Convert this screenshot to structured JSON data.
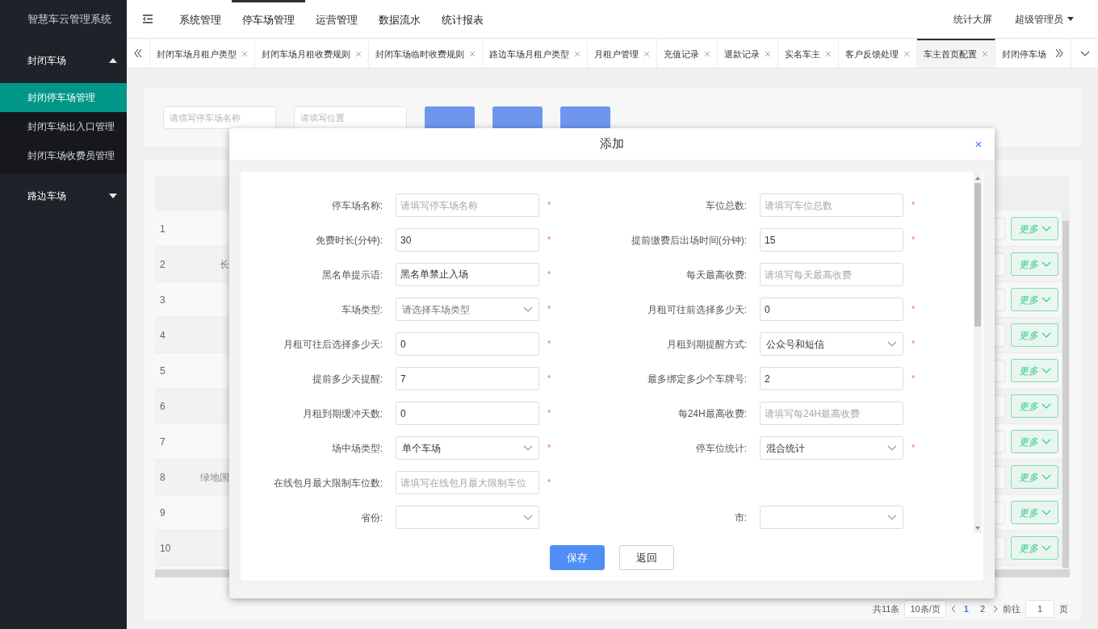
{
  "sidebar": {
    "title": "智慧车云管理系统",
    "groups": [
      {
        "label": "封闭车场",
        "expanded": true,
        "children": [
          {
            "label": "封闭停车场管理",
            "selected": true
          },
          {
            "label": "封闭车场出入口管理",
            "selected": false
          },
          {
            "label": "封闭车场收费员管理",
            "selected": false
          }
        ]
      },
      {
        "label": "路边车场",
        "expanded": false
      }
    ]
  },
  "header": {
    "menus": [
      {
        "label": "系统管理",
        "selected": false
      },
      {
        "label": "停车场管理",
        "selected": true
      },
      {
        "label": "运营管理",
        "selected": false
      },
      {
        "label": "数据流水",
        "selected": false
      },
      {
        "label": "统计报表",
        "selected": false
      }
    ],
    "link": "统计大屏",
    "user": "超级管理员"
  },
  "tabs": [
    {
      "label": "封闭车场月租户类型",
      "selected": false,
      "closable": true
    },
    {
      "label": "封闭车场月租收费规则",
      "selected": false,
      "closable": true
    },
    {
      "label": "封闭车场临时收费规则",
      "selected": false,
      "closable": true
    },
    {
      "label": "路边车场月租户类型",
      "selected": false,
      "closable": true
    },
    {
      "label": "月租户管理",
      "selected": false,
      "closable": true
    },
    {
      "label": "充值记录",
      "selected": false,
      "closable": true
    },
    {
      "label": "退款记录",
      "selected": false,
      "closable": true
    },
    {
      "label": "实名车主",
      "selected": false,
      "closable": true
    },
    {
      "label": "客户反馈处理",
      "selected": false,
      "closable": true
    },
    {
      "label": "车主首页配置",
      "selected": true,
      "closable": true
    },
    {
      "label": "封闭停车场",
      "selected": false,
      "closable": false
    }
  ],
  "search": {
    "fields": [
      {
        "placeholder": "请填写停车场名称"
      },
      {
        "placeholder": "请填写位置"
      }
    ]
  },
  "table": {
    "rows": [
      {
        "index": "1",
        "action": "更多"
      },
      {
        "index": "2",
        "name": "长",
        "action": "更多"
      },
      {
        "index": "3",
        "action": "更多"
      },
      {
        "index": "4",
        "action": "更多"
      },
      {
        "index": "5",
        "action": "更多"
      },
      {
        "index": "6",
        "action": "更多"
      },
      {
        "index": "7",
        "action": "更多"
      },
      {
        "index": "8",
        "name": "绿地国",
        "action": "更多"
      },
      {
        "index": "9",
        "action": "更多"
      },
      {
        "index": "10",
        "action": "更多"
      }
    ]
  },
  "pagination": {
    "total": "共11条",
    "page_size": "10条/页",
    "pages": [
      {
        "label": "1",
        "selected": true
      },
      {
        "label": "2",
        "selected": false
      }
    ],
    "goto_label": "前往",
    "goto_value": "1",
    "goto_suffix": "页"
  },
  "modal": {
    "title": "添加",
    "rows": [
      {
        "left": {
          "label": "停车场名称:",
          "kind": "input",
          "placeholder": "请填写停车场名称",
          "required_mark": "*"
        },
        "right": {
          "label": "车位总数:",
          "kind": "input",
          "placeholder": "请填写车位总数",
          "required_mark": "*"
        }
      },
      {
        "left": {
          "label": "免费时长(分钟):",
          "kind": "input",
          "value": "30",
          "required_mark": "*"
        },
        "right": {
          "label": "提前缴费后出场时间(分钟):",
          "kind": "input",
          "value": "15",
          "required_mark": "*"
        }
      },
      {
        "left": {
          "label": "黑名单提示语:",
          "kind": "input",
          "value": "黑名单禁止入场",
          "required_mark": "*"
        },
        "right": {
          "label": "每天最高收费:",
          "kind": "input",
          "placeholder": "请填写每天最高收费"
        }
      },
      {
        "left": {
          "label": "车场类型:",
          "kind": "select",
          "placeholder": "请选择车场类型",
          "required_mark": "*"
        },
        "right": {
          "label": "月租可往前选择多少天:",
          "kind": "input",
          "value": "0",
          "required_mark": "*"
        }
      },
      {
        "left": {
          "label": "月租可往后选择多少天:",
          "kind": "input",
          "value": "0",
          "required_mark": "*"
        },
        "right": {
          "label": "月租到期提醒方式:",
          "kind": "select",
          "value": "公众号和短信",
          "required_mark": "*"
        }
      },
      {
        "left": {
          "label": "提前多少天提醒:",
          "kind": "input",
          "value": "7",
          "required_mark": "*"
        },
        "right": {
          "label": "最多绑定多少个车牌号:",
          "kind": "input",
          "value": "2",
          "required_mark": "*"
        }
      },
      {
        "left": {
          "label": "月租到期缓冲天数:",
          "kind": "input",
          "value": "0",
          "required_mark": "*"
        },
        "right": {
          "label": "每24H最高收费:",
          "kind": "input",
          "placeholder": "请填写每24H最高收费"
        }
      },
      {
        "left": {
          "label": "场中场类型:",
          "kind": "select",
          "value": "单个车场",
          "required_mark": "*"
        },
        "right": {
          "label": "停车位统计:",
          "kind": "select",
          "value": "混合统计",
          "required_mark": "*"
        }
      },
      {
        "left": {
          "label": "在线包月最大限制车位数:",
          "kind": "input",
          "placeholder": "请填写在线包月最大限制车位",
          "required_mark": "*"
        }
      },
      {
        "left": {
          "label": "省份:",
          "kind": "select"
        },
        "right": {
          "label": "市:",
          "kind": "select"
        }
      }
    ],
    "buttons": [
      {
        "label": "保存",
        "kind": "primary"
      },
      {
        "label": "返回",
        "kind": "default"
      }
    ]
  }
}
